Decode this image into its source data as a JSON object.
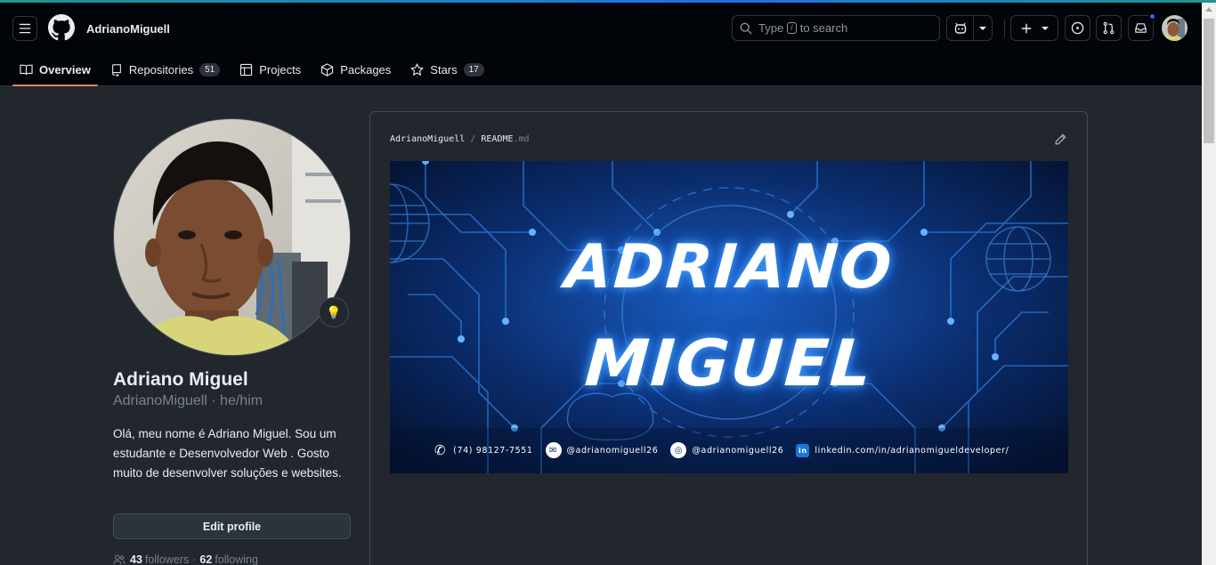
{
  "header": {
    "owner": "AdrianoMiguell",
    "search_pre": "Type",
    "search_key": "/",
    "search_post": "to search"
  },
  "tabs": [
    {
      "label": "Overview",
      "icon": "book-icon",
      "active": true
    },
    {
      "label": "Repositories",
      "count": "51",
      "icon": "repo-icon"
    },
    {
      "label": "Projects",
      "icon": "table-icon"
    },
    {
      "label": "Packages",
      "icon": "package-icon"
    },
    {
      "label": "Stars",
      "count": "17",
      "icon": "star-icon"
    }
  ],
  "profile": {
    "name": "Adriano Miguel",
    "login": "AdrianoMiguell · he/him",
    "bio": "Olá, meu nome é Adriano Miguel. Sou um estudante e Desenvolvedor Web . Gosto muito de desenvolver soluções e websites.",
    "edit_label": "Edit profile",
    "followers_count": "43",
    "followers_label": "followers",
    "separator": "·",
    "following_count": "62",
    "following_label": "following",
    "status_emoji": "💡"
  },
  "readme": {
    "owner": "AdrianoMiguell",
    "sep": "/",
    "file": "README",
    "ext": ".md",
    "banner": {
      "line1": "ADRIANO",
      "line2": "MIGUEL",
      "phone": "(74) 98127-7551",
      "email": "@adrianomiguell26",
      "instagram": "@adrianomiguell26",
      "linkedin": "linkedin.com/in/adrianomigueldeveloper/"
    }
  },
  "colors": {
    "accent_tab": "#f78166",
    "notification": "#1f6feb",
    "canvas": "#22272e"
  }
}
